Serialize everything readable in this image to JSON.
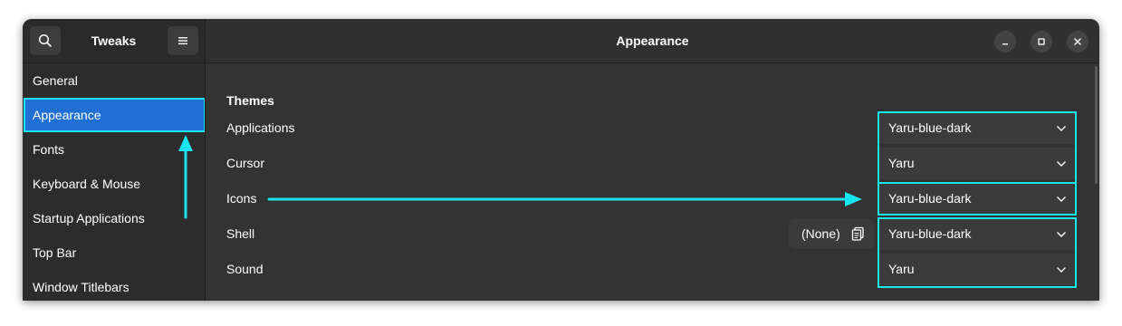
{
  "header": {
    "app_title": "Tweaks",
    "page_title": "Appearance",
    "search_icon": "search-icon",
    "menu_icon": "hamburger-menu-icon",
    "window_controls": [
      "minimize-icon",
      "maximize-icon",
      "close-icon"
    ]
  },
  "sidebar": {
    "items": [
      {
        "label": "General"
      },
      {
        "label": "Appearance",
        "selected": true
      },
      {
        "label": "Fonts"
      },
      {
        "label": "Keyboard & Mouse"
      },
      {
        "label": "Startup Applications"
      },
      {
        "label": "Top Bar"
      },
      {
        "label": "Window Titlebars"
      }
    ]
  },
  "main": {
    "section_title": "Themes",
    "rows": [
      {
        "label": "Applications",
        "value": "Yaru-blue-dark"
      },
      {
        "label": "Cursor",
        "value": "Yaru"
      },
      {
        "label": "Icons",
        "value": "Yaru-blue-dark"
      },
      {
        "label": "Shell",
        "value": "Yaru-blue-dark",
        "file_button": "(None)"
      },
      {
        "label": "Sound",
        "value": "Yaru"
      }
    ]
  },
  "colors": {
    "accent": "#1f6fd4",
    "annotation": "#17e6ee",
    "window_bg": "#2c2c2c",
    "content_bg": "#333333"
  }
}
